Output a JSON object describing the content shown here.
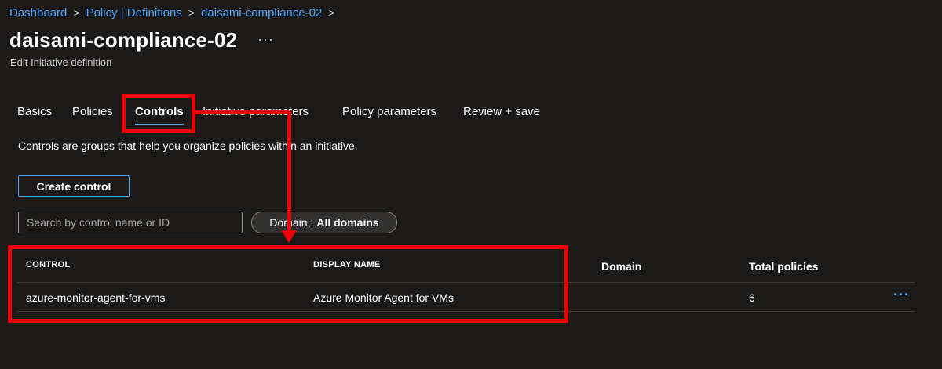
{
  "breadcrumb": {
    "items": [
      "Dashboard",
      "Policy | Definitions",
      "daisami-compliance-02"
    ],
    "separator": ">"
  },
  "header": {
    "title": "daisami-compliance-02",
    "more": "···",
    "subtitle": "Edit Initiative definition"
  },
  "tabs": [
    {
      "label": "Basics"
    },
    {
      "label": "Policies"
    },
    {
      "label": "Controls",
      "active": true
    },
    {
      "label": "Initiative parameters"
    },
    {
      "label": "Policy parameters"
    },
    {
      "label": "Review + save"
    }
  ],
  "main": {
    "description": "Controls are groups that help you organize policies within an initiative.",
    "create_button": "Create control",
    "search_placeholder": "Search by control name or ID",
    "domain_filter": {
      "label": "Domain :",
      "value": "All domains"
    }
  },
  "table": {
    "columns": [
      "CONTROL",
      "DISPLAY NAME",
      "Domain",
      "Total policies"
    ],
    "rows": [
      {
        "control": "azure-monitor-agent-for-vms",
        "display_name": "Azure Monitor Agent for VMs",
        "domain": "",
        "total_policies": "6",
        "more": "···"
      }
    ]
  },
  "colors": {
    "background": "#1b1a19",
    "accent": "#4fa3f7",
    "annotation": "#e8000b"
  }
}
